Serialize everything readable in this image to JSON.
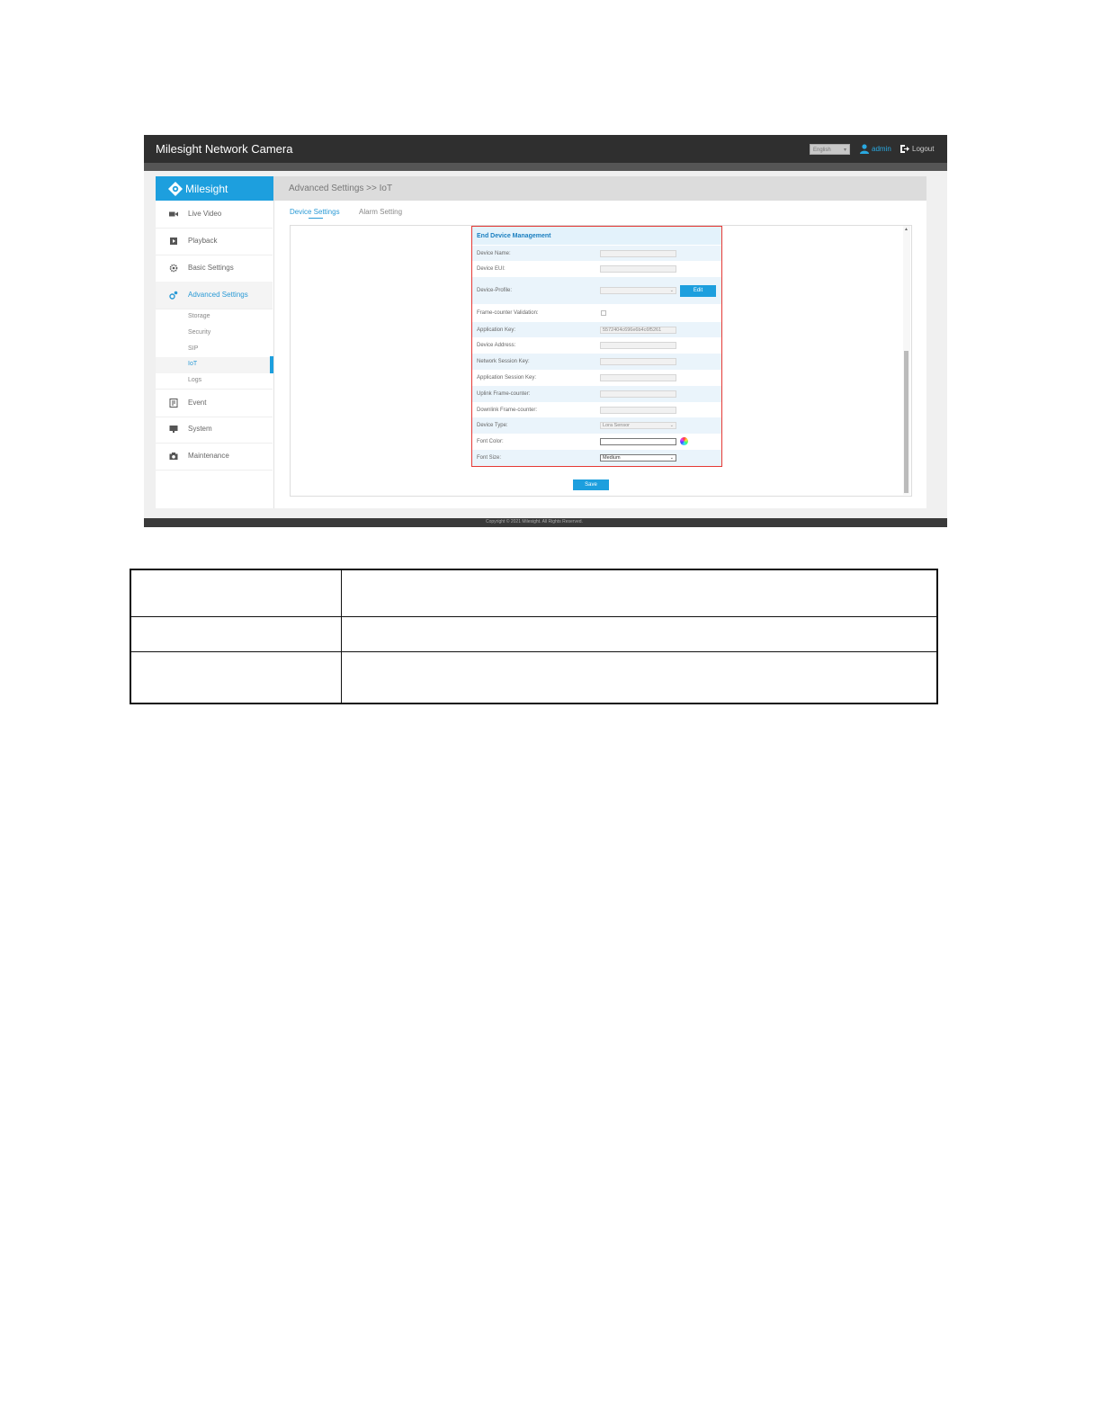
{
  "header": {
    "app_title": "Milesight Network Camera",
    "language": "English",
    "user": "admin",
    "logout": "Logout"
  },
  "sidebar": {
    "brand": "Milesight",
    "items": [
      {
        "label": "Live Video",
        "icon": "video-camera-icon"
      },
      {
        "label": "Playback",
        "icon": "playback-icon"
      },
      {
        "label": "Basic Settings",
        "icon": "gear-icon"
      },
      {
        "label": "Advanced Settings",
        "icon": "advanced-settings-icon",
        "active": true
      },
      {
        "label": "Event",
        "icon": "event-icon"
      },
      {
        "label": "System",
        "icon": "monitor-icon"
      },
      {
        "label": "Maintenance",
        "icon": "camera-maintenance-icon"
      }
    ],
    "sub_items": [
      "Storage",
      "Security",
      "SIP",
      "IoT",
      "Logs"
    ],
    "active_sub_item": "IoT"
  },
  "breadcrumb": "Advanced Settings >> IoT",
  "tabs": [
    "Device Settings",
    "Alarm Setting"
  ],
  "active_tab": "Device Settings",
  "panel": {
    "title": "End Device Management",
    "fields": [
      {
        "label": "Device Name:",
        "value": ""
      },
      {
        "label": "Device EUI:",
        "value": ""
      },
      {
        "label": "Device-Profile:",
        "value": ""
      },
      {
        "label": "Frame-counter Validation:",
        "checked": false
      },
      {
        "label": "Application Key:",
        "value": "5572404c696e6b4c6f5261"
      },
      {
        "label": "Device Address:",
        "value": ""
      },
      {
        "label": "Network Session Key:",
        "value": ""
      },
      {
        "label": "Application Session Key:",
        "value": ""
      },
      {
        "label": "Uplink Frame-counter:",
        "value": ""
      },
      {
        "label": "Downlink Frame-counter:",
        "value": ""
      },
      {
        "label": "Device Type:",
        "value": "Lora Sensor"
      },
      {
        "label": "Font Color:",
        "value": ""
      },
      {
        "label": "Font Size:",
        "value": "Medium"
      }
    ],
    "edit_label": "Edit"
  },
  "save_label": "Save",
  "footer": "Copyright © 2021 Milesight. All Rights Reserved.",
  "colors": {
    "accent": "#1d9fde",
    "topbar": "#2f2f2f",
    "highlight_border": "#e53935"
  }
}
